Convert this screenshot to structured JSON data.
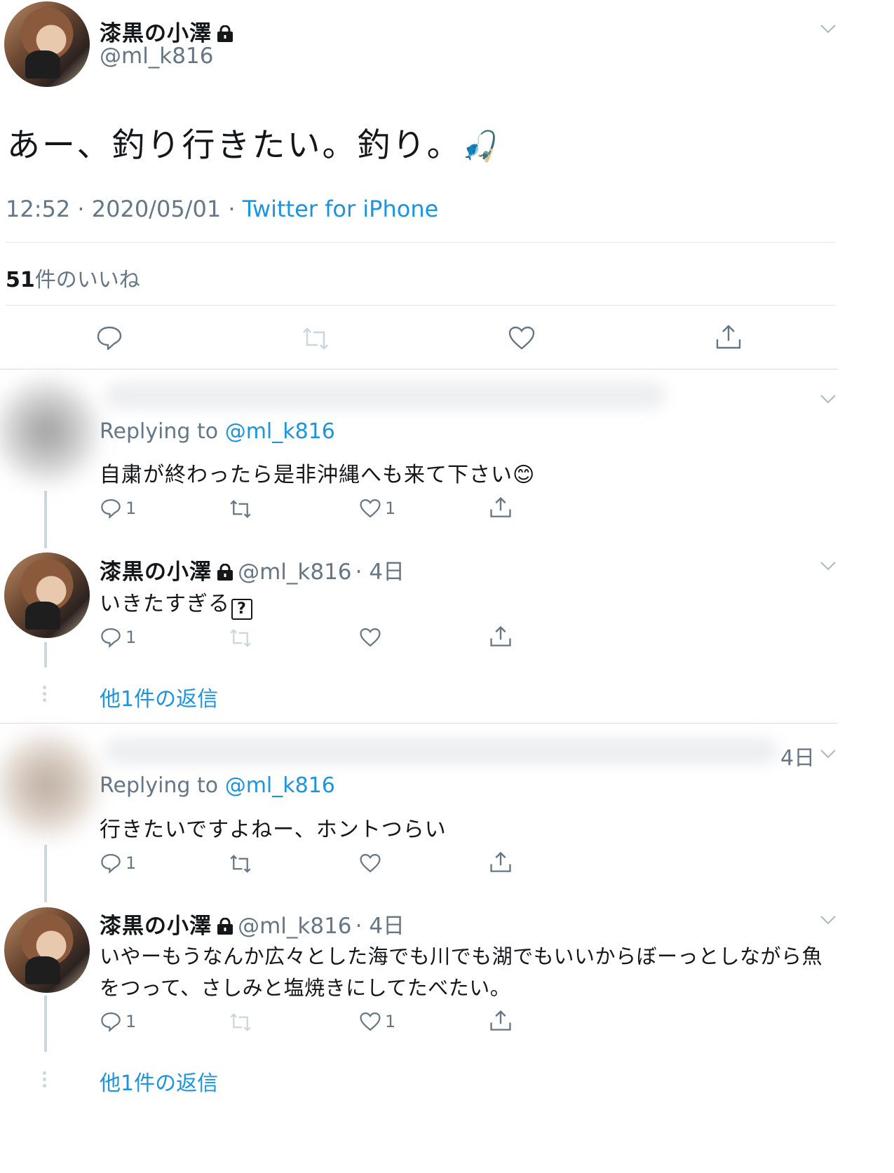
{
  "tweet": {
    "name": "漆黒の小澤",
    "handle": "@ml_k816",
    "text": "あー、釣り行きたい。釣り。",
    "emoji": "🎣",
    "time": "12:52",
    "date": "2020/05/01",
    "separator": "·",
    "source": "Twitter for iPhone",
    "likes_count": "51",
    "likes_label": "件のいいね"
  },
  "replies": [
    {
      "replying_prefix": "Replying to",
      "replying_handle": "@ml_k816",
      "text": "自粛が終わったら是非沖縄へも来て下さい😊",
      "reply_count": "1",
      "like_count": "1"
    },
    {
      "name": "漆黒の小澤",
      "handle": "@ml_k816",
      "age": "· 4日",
      "text": "いきたすぎる",
      "unknown_glyph": "?",
      "reply_count": "1"
    },
    {
      "more_replies": "他1件の返信"
    },
    {
      "age": "4日",
      "replying_prefix": "Replying to",
      "replying_handle": "@ml_k816",
      "text": "行きたいですよねー、ホントつらい",
      "reply_count": "1"
    },
    {
      "name": "漆黒の小澤",
      "handle": "@ml_k816",
      "age": "· 4日",
      "text_line1": "いやーもうなんか広々とした海でも川でも湖でもいいからぼーっとしながら魚",
      "text_line2": "をつって、さしみと塩焼きにしてたべたい。",
      "reply_count": "1",
      "like_count": "1"
    },
    {
      "more_replies": "他1件の返信"
    }
  ],
  "colors": {
    "link": "#1b95e0",
    "muted": "#657786",
    "divider": "#e1e8ed",
    "thread": "#ccd6dd"
  }
}
